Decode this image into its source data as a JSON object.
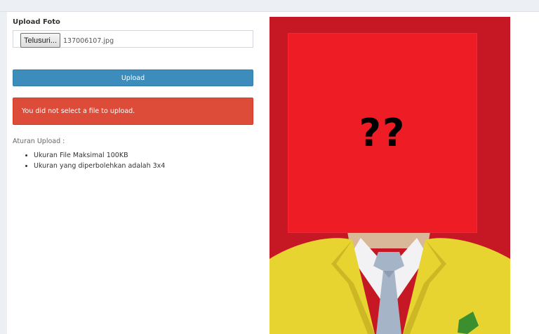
{
  "form": {
    "section_label": "Upload Foto",
    "browse_button_label": "Telusuri...",
    "selected_file_name": "137006107.jpg",
    "upload_button_label": "Upload",
    "error_message": "You did not select a file to upload."
  },
  "rules": {
    "title": "Aturan Upload :",
    "items": [
      "Ukuran File Maksimal 100KB",
      "Ukuran yang diperbolehkan adalah 3x4"
    ]
  },
  "photo": {
    "censor_text": "??",
    "colors": {
      "background": "#c51824",
      "censor_box": "#ee1c25",
      "blazer": "#e8d431",
      "tie": "#a6b4c8"
    }
  },
  "colors": {
    "primary": "#3c8dbc",
    "danger": "#dd4b39",
    "page_background": "#ecf0f5"
  }
}
